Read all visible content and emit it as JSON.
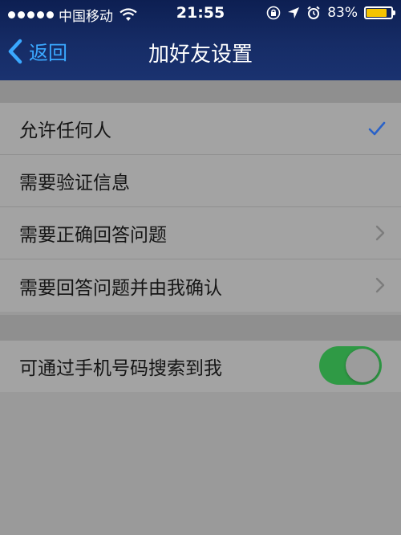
{
  "status_bar": {
    "carrier": "中国移动",
    "time": "21:55",
    "battery": "83%",
    "battery_level": 0.83
  },
  "navbar": {
    "back_label": "返回",
    "title": "加好友设置"
  },
  "options": [
    {
      "label": "允许任何人",
      "selected": true
    },
    {
      "label": "需要验证信息",
      "selected": false
    },
    {
      "label": "需要正确回答问题",
      "selected": false
    },
    {
      "label": "需要回答问题并由我确认",
      "selected": false
    }
  ],
  "search_setting": {
    "label": "可通过手机号码搜索到我",
    "enabled": true
  },
  "colors": {
    "accent": "#3aa8ff",
    "check": "#2a62c8",
    "toggle_on": "#2f9a45",
    "battery": "#f5c400"
  }
}
